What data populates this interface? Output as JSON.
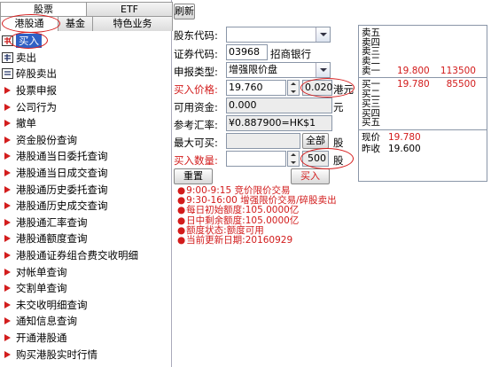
{
  "tabs_top": [
    "股票",
    "ETF"
  ],
  "tabs_sub": [
    "港股通",
    "基金",
    "特色业务"
  ],
  "menu": [
    {
      "label": "买入",
      "icon": "buy-icon",
      "selected": true
    },
    {
      "label": "卖出",
      "icon": "sell-icon"
    },
    {
      "label": "碎股卖出",
      "icon": "odd-lot-icon"
    },
    {
      "label": "投票申报",
      "icon": "arrow-icon"
    },
    {
      "label": "公司行为",
      "icon": "arrow-icon"
    },
    {
      "label": "撤单",
      "icon": "arrow-icon"
    },
    {
      "label": "资金股份查询",
      "icon": "arrow-icon"
    },
    {
      "label": "港股通当日委托查询",
      "icon": "arrow-icon"
    },
    {
      "label": "港股通当日成交查询",
      "icon": "arrow-icon"
    },
    {
      "label": "港股通历史委托查询",
      "icon": "arrow-icon"
    },
    {
      "label": "港股通历史成交查询",
      "icon": "arrow-icon"
    },
    {
      "label": "港股通汇率查询",
      "icon": "arrow-icon"
    },
    {
      "label": "港股通额度查询",
      "icon": "arrow-icon"
    },
    {
      "label": "港股通证券组合费交收明细",
      "icon": "arrow-icon"
    },
    {
      "label": "对帐单查询",
      "icon": "arrow-icon"
    },
    {
      "label": "交割单查询",
      "icon": "arrow-icon"
    },
    {
      "label": "未交收明细查询",
      "icon": "arrow-icon"
    },
    {
      "label": "通知信息查询",
      "icon": "arrow-icon"
    },
    {
      "label": "开通港股通",
      "icon": "arrow-icon"
    },
    {
      "label": "购买港股实时行情",
      "icon": "arrow-icon"
    }
  ],
  "toolbar": {
    "refresh": "刷新"
  },
  "form": {
    "account_label": "股东代码:",
    "account_value": "",
    "code_label": "证券代码:",
    "code_value": "03968",
    "code_name": "招商银行",
    "type_label": "申报类型:",
    "type_value": "增强限价盘",
    "price_label": "买入价格:",
    "price_value": "19.760",
    "price_step": "0.020",
    "price_unit": "港元",
    "funds_label": "可用资金:",
    "funds_value": "0.000",
    "funds_unit": "元",
    "rate_label": "参考汇率:",
    "rate_value": "¥0.887900=HK$1",
    "max_label": "最大可买:",
    "max_value": "",
    "all_button": "全部",
    "max_unit": "股",
    "qty_label": "买入数量:",
    "qty_value": "",
    "qty_step": "500",
    "qty_unit": "股",
    "reset_button": "重置",
    "buy_button": "买入"
  },
  "notes": [
    "9:00-9:15   竞价限价交易",
    "9:30-16:00 增强限价交易/碎股卖出",
    "每日初始额度:105.0000亿",
    "日中剩余额度:105.0000亿",
    "额度状态:额度可用",
    "当前更新日期:20160929"
  ],
  "book": {
    "asks": [
      {
        "name": "卖五",
        "price": "",
        "vol": ""
      },
      {
        "name": "卖四",
        "price": "",
        "vol": ""
      },
      {
        "name": "卖三",
        "price": "",
        "vol": ""
      },
      {
        "name": "卖二",
        "price": "",
        "vol": ""
      },
      {
        "name": "卖一",
        "price": "19.800",
        "vol": "113500"
      }
    ],
    "bids": [
      {
        "name": "买一",
        "price": "19.780",
        "vol": "85500"
      },
      {
        "name": "买二",
        "price": "",
        "vol": ""
      },
      {
        "name": "买三",
        "price": "",
        "vol": ""
      },
      {
        "name": "买四",
        "price": "",
        "vol": ""
      },
      {
        "name": "买五",
        "price": "",
        "vol": ""
      }
    ],
    "last_label": "现价",
    "last_value": "19.780",
    "prev_label": "昨收",
    "prev_value": "19.600"
  },
  "colors": {
    "accent_red": "#d21b1b",
    "selection_blue": "#2f61c5"
  }
}
